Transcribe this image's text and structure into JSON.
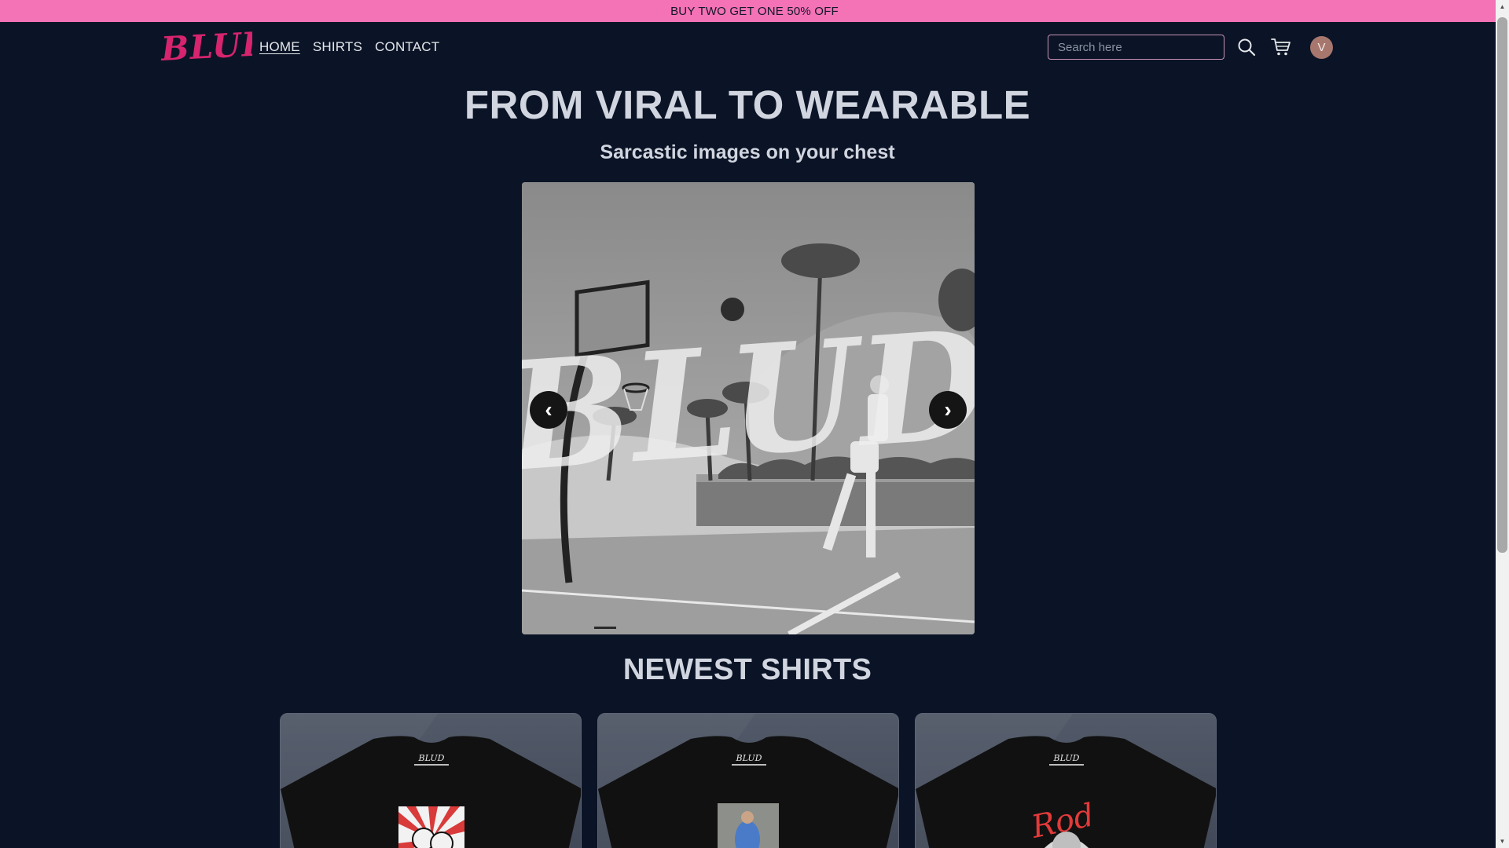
{
  "promo": {
    "text": "BUY TWO GET ONE 50% OFF"
  },
  "header": {
    "logo_text": "BLUD",
    "nav": [
      {
        "label": "HOME",
        "active": true
      },
      {
        "label": "SHIRTS",
        "active": false
      },
      {
        "label": "CONTACT",
        "active": false
      }
    ],
    "search_placeholder": "Search here",
    "search_icon": "search-icon",
    "cart_icon": "cart-icon",
    "avatar_initial": "V"
  },
  "hero": {
    "title": "FROM VIRAL TO WEARABLE",
    "subtitle": "Sarcastic images on your chest",
    "carousel": {
      "overlay_text": "BLUD",
      "prev_label": "‹",
      "next_label": "›",
      "slide_count": 3,
      "active_slide": 1
    }
  },
  "newest": {
    "title": "NEWEST SHIRTS",
    "cards": [
      {
        "shirt_logo": "BLUD",
        "graphic": "rising-sun-print"
      },
      {
        "shirt_logo": "BLUD",
        "graphic": "photo-print"
      },
      {
        "shirt_logo": "BLUD",
        "graphic": "red-signature-print",
        "graphic_text": "Rod"
      }
    ]
  },
  "colors": {
    "background": "#0b1426",
    "promo": "#f472b6",
    "brand": "#d6246e",
    "card": "#4a5262"
  }
}
